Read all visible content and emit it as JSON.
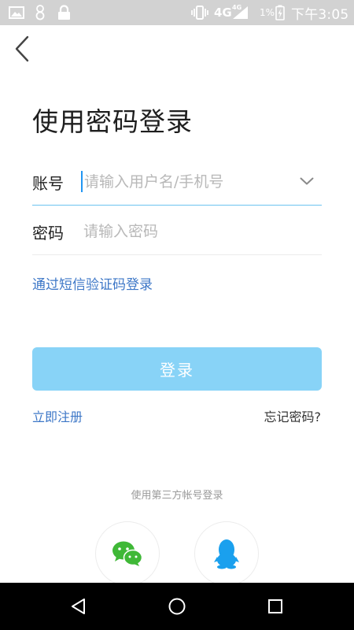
{
  "status_bar": {
    "network": "4G",
    "network_small": "4G",
    "battery": "1%",
    "time": "下午3:05",
    "icons": [
      "image-icon",
      "person-icon",
      "lock-icon",
      "vibrate-icon",
      "signal-icon",
      "battery-icon"
    ]
  },
  "page": {
    "title": "使用密码登录"
  },
  "form": {
    "account_label": "账号",
    "account_placeholder": "请输入用户名/手机号",
    "password_label": "密码",
    "password_placeholder": "请输入密码",
    "sms_login_link": "通过短信验证码登录",
    "login_button": "登录",
    "register_link": "立即注册",
    "forgot_link": "忘记密码?"
  },
  "third_party": {
    "label": "使用第三方帐号登录",
    "providers": [
      "wechat-icon",
      "qq-icon"
    ]
  },
  "nav_bar": {
    "icons": [
      "back-triangle-icon",
      "home-circle-icon",
      "recents-square-icon"
    ]
  },
  "colors": {
    "accent": "#2196f3",
    "link": "#3d77c7",
    "button": "#88d3f7",
    "wechat": "#3fb837",
    "qq": "#1aa0ee"
  }
}
